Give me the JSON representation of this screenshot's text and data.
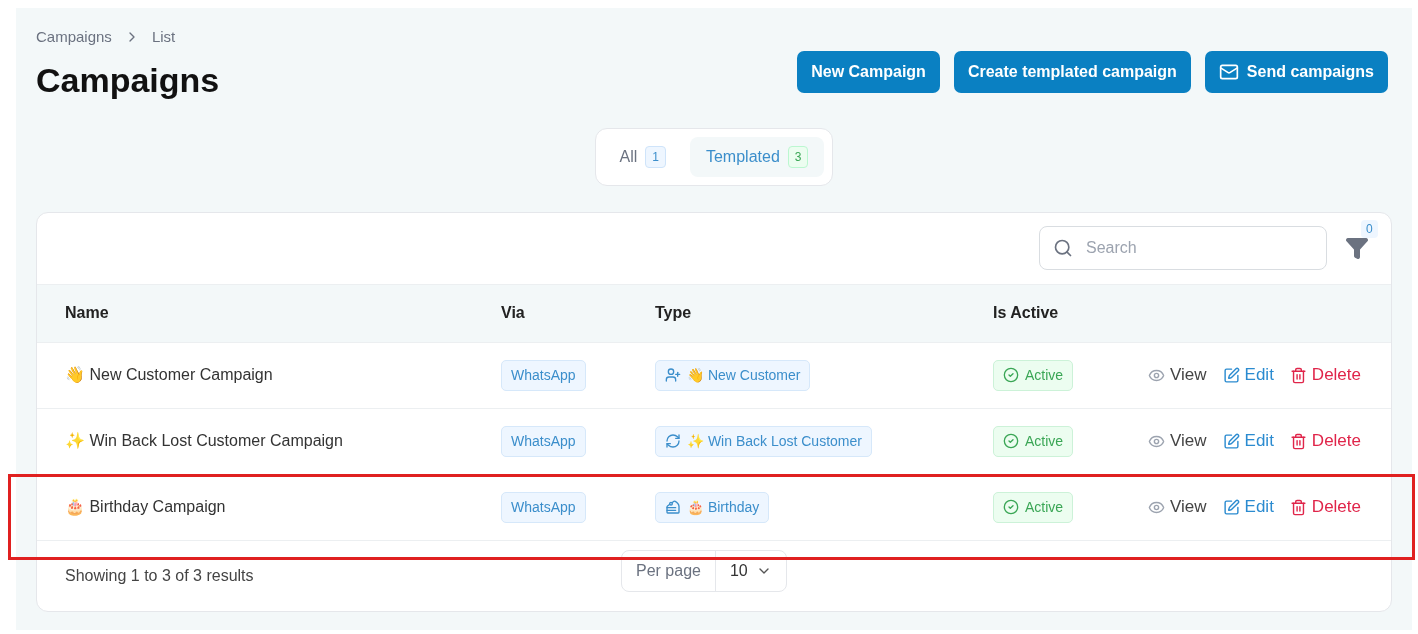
{
  "breadcrumb": [
    "Campaigns",
    "List"
  ],
  "title": "Campaigns",
  "actions": [
    {
      "label": "New Campaign",
      "kind": "plain"
    },
    {
      "label": "Create templated campaign",
      "kind": "plain"
    },
    {
      "label": "Send campaigns",
      "kind": "mail"
    }
  ],
  "tabs": [
    {
      "label": "All",
      "count": "1",
      "selected": false
    },
    {
      "label": "Templated",
      "count": "3",
      "selected": true
    }
  ],
  "search": {
    "placeholder": "Search"
  },
  "filter": {
    "count": "0"
  },
  "table": {
    "columns": [
      "Name",
      "Via",
      "Type",
      "Is Active"
    ],
    "rows": [
      {
        "name": "👋 New Customer Campaign",
        "via": "WhatsApp",
        "type": {
          "kind": "user-plus",
          "label": "👋 New Customer"
        },
        "status": "Active",
        "active": true,
        "highlighted": false,
        "actions": [
          "View",
          "Edit",
          "Delete"
        ]
      },
      {
        "name": "✨ Win Back Lost Customer Campaign",
        "via": "WhatsApp",
        "type": {
          "kind": "refresh",
          "label": "✨ Win Back Lost Customer"
        },
        "status": "Active",
        "active": true,
        "highlighted": false,
        "actions": [
          "View",
          "Edit",
          "Delete"
        ]
      },
      {
        "name": "🎂 Birthday Campaign",
        "via": "WhatsApp",
        "type": {
          "kind": "cake",
          "label": "🎂 Birthday"
        },
        "status": "Active",
        "active": true,
        "highlighted": true,
        "actions": [
          "View",
          "Edit",
          "Delete"
        ]
      }
    ]
  },
  "footer": {
    "summary": "Showing 1 to 3 of 3 results",
    "per_page_label": "Per page",
    "per_page": "10"
  }
}
